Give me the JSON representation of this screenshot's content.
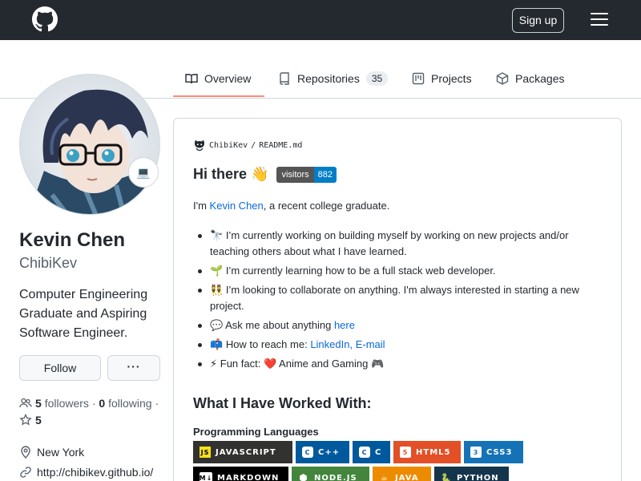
{
  "header": {
    "signup_label": "Sign up"
  },
  "tabs": [
    {
      "label": "Overview"
    },
    {
      "label": "Repositories",
      "count": "35"
    },
    {
      "label": "Projects"
    },
    {
      "label": "Packages"
    }
  ],
  "profile": {
    "full_name": "Kevin Chen",
    "username": "ChibiKev",
    "status_emoji": "💻",
    "bio": "Computer Engineering Graduate and Aspiring Software Engineer.",
    "follow_label": "Follow",
    "more_label": "···",
    "followers_count": "5",
    "followers_label": "followers",
    "following_count": "0",
    "following_label": "following",
    "separator": "·",
    "stars_count": "5",
    "location": "New York",
    "website": "http://chibikev.github.io/"
  },
  "readme": {
    "path_owner": "ChibiKev",
    "path_sep": "/",
    "path_file": "README.md",
    "heading": "Hi there 👋",
    "visitors_label": "visitors",
    "visitors_count": "882",
    "intro_pre": "I'm ",
    "intro_link": "Kevin Chen",
    "intro_post": ", a recent college graduate.",
    "bullets": [
      {
        "emoji": "🔭",
        "text": "I’m currently working on building myself by working on new projects and/or teaching others about what I have learned."
      },
      {
        "emoji": "🌱",
        "text": "I’m currently learning how to be a full stack web developer."
      },
      {
        "emoji": "👯",
        "text": "I’m looking to collaborate on anything. I'm always interested in starting a new project."
      },
      {
        "emoji": "💬",
        "text": "Ask me about anything ",
        "link": "here"
      },
      {
        "emoji": "📫",
        "text": "How to reach me: ",
        "link": "LinkedIn",
        "sep": ", ",
        "link2": "E-mail"
      },
      {
        "emoji": "⚡",
        "text": "Fun fact: ",
        "heart": "❤️",
        "tail": " Anime and Gaming ",
        "emoji2": "🎮"
      }
    ],
    "worked_heading": "What I Have Worked With:",
    "prog_heading": "Programming Languages",
    "badges": [
      {
        "label": "JAVASCRIPT",
        "icon": "JS",
        "color": "#323330",
        "icon_bg": "#f7df1e",
        "icon_fg": "#000000"
      },
      {
        "label": "C++",
        "icon": "C",
        "color": "#00599c",
        "icon_bg": "#ffffff",
        "icon_fg": "#00599c"
      },
      {
        "label": "C",
        "icon": "C",
        "color": "#00599c",
        "icon_bg": "#ffffff",
        "icon_fg": "#00599c"
      },
      {
        "label": "HTML5",
        "icon": "5",
        "color": "#e34f26",
        "icon_bg": "#ffffff",
        "icon_fg": "#e34f26"
      },
      {
        "label": "CSS3",
        "icon": "3",
        "color": "#1572b6",
        "icon_bg": "#ffffff",
        "icon_fg": "#1572b6"
      },
      {
        "label": "MARKDOWN",
        "icon": "M↓",
        "color": "#000000",
        "icon_bg": "#ffffff",
        "icon_fg": "#000000"
      },
      {
        "label": "NODE.JS",
        "icon": "⬢",
        "color": "#43853d",
        "icon_bg": "#43853d",
        "icon_fg": "#ffffff"
      },
      {
        "label": "JAVA",
        "icon": "☕",
        "color": "#ed8b00",
        "icon_bg": "#ed8b00",
        "icon_fg": "#ffffff"
      },
      {
        "label": "PYTHON",
        "icon": "🐍",
        "color": "#14354c",
        "icon_bg": "#14354c",
        "icon_fg": "#ffffff"
      }
    ]
  }
}
